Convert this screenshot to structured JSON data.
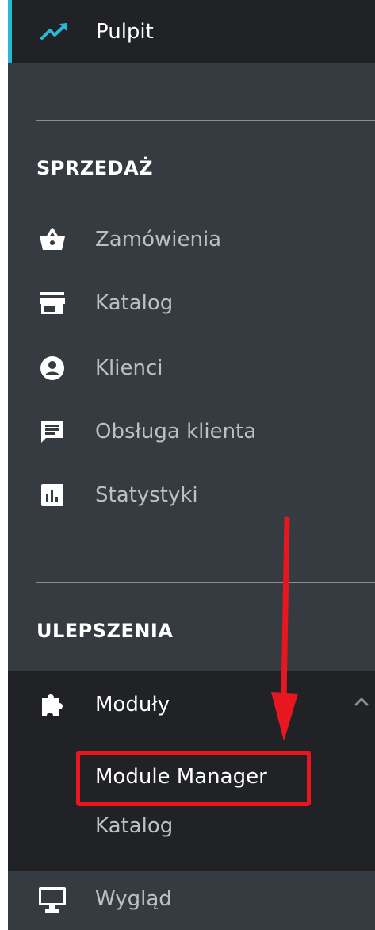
{
  "dashboard": {
    "label": "Pulpit",
    "icon": "trending-up-icon"
  },
  "sections": {
    "sales": {
      "title": "SPRZEDAŻ",
      "items": [
        {
          "label": "Zamówienia",
          "icon": "shopping-basket-icon"
        },
        {
          "label": "Katalog",
          "icon": "store-icon"
        },
        {
          "label": "Klienci",
          "icon": "account-circle-icon"
        },
        {
          "label": "Obsługa klienta",
          "icon": "chat-icon"
        },
        {
          "label": "Statystyki",
          "icon": "bar-chart-icon"
        }
      ]
    },
    "improvements": {
      "title": "ULEPSZENIA",
      "modules": {
        "label": "Moduły",
        "icon": "puzzle-icon",
        "expanded": true,
        "submenu": [
          {
            "label": "Module Manager",
            "active": true
          },
          {
            "label": "Katalog",
            "active": false
          }
        ]
      },
      "design": {
        "label": "Wygląd",
        "icon": "monitor-icon"
      }
    }
  },
  "colors": {
    "sidebar_bg": "#363a41",
    "active_bg": "#202226",
    "accent": "#25b9d7",
    "annotation": "#e8171f"
  }
}
